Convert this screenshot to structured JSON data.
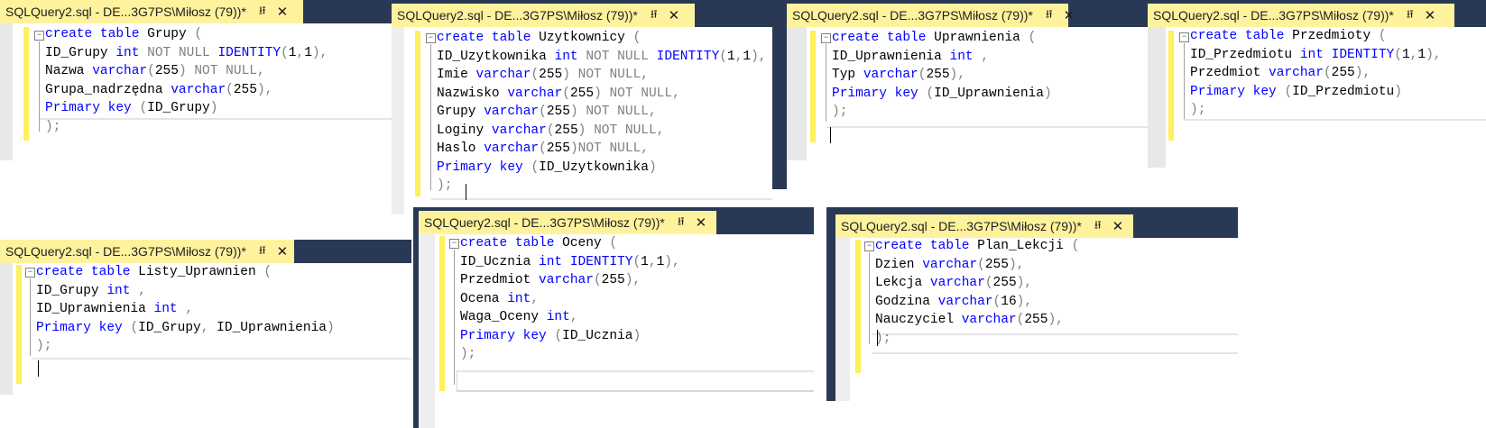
{
  "tab": {
    "title": "SQLQuery2.sql - DE...3G7PS\\Miłosz (79))*",
    "pin_icon": "pin-icon",
    "close_icon": "close-icon"
  },
  "windows": [
    {
      "name": "grupy",
      "lines": [
        [
          [
            "kw",
            "create"
          ],
          [
            "t",
            " "
          ],
          [
            "kw",
            "table"
          ],
          [
            "t",
            " Grupy "
          ],
          [
            "sym",
            "("
          ]
        ],
        [
          [
            "t",
            "ID_Grupy "
          ],
          [
            "kw",
            "int"
          ],
          [
            "t",
            " "
          ],
          [
            "nn",
            "NOT NULL"
          ],
          [
            "t",
            " "
          ],
          [
            "kw",
            "IDENTITY"
          ],
          [
            "sym",
            "("
          ],
          [
            "t",
            "1"
          ],
          [
            "sym",
            ","
          ],
          [
            "t",
            "1"
          ],
          [
            "sym",
            "),"
          ]
        ],
        [
          [
            "t",
            "Nazwa "
          ],
          [
            "kw",
            "varchar"
          ],
          [
            "sym",
            "("
          ],
          [
            "t",
            "255"
          ],
          [
            "sym",
            ")"
          ],
          [
            "t",
            " "
          ],
          [
            "nn",
            "NOT NULL"
          ],
          [
            "sym",
            ","
          ]
        ],
        [
          [
            "t",
            "Grupa_nadrzędna "
          ],
          [
            "kw",
            "varchar"
          ],
          [
            "sym",
            "("
          ],
          [
            "t",
            "255"
          ],
          [
            "sym",
            "),"
          ]
        ],
        [
          [
            "kw",
            "Primary"
          ],
          [
            "t",
            " "
          ],
          [
            "kw",
            "key"
          ],
          [
            "t",
            " "
          ],
          [
            "sym",
            "("
          ],
          [
            "t",
            "ID_Grupy"
          ],
          [
            "sym",
            ")"
          ]
        ],
        [
          [
            "sym",
            ");"
          ]
        ]
      ]
    },
    {
      "name": "uzytkownicy",
      "lines": [
        [
          [
            "kw",
            "create"
          ],
          [
            "t",
            " "
          ],
          [
            "kw",
            "table"
          ],
          [
            "t",
            " Uzytkownicy "
          ],
          [
            "sym",
            "("
          ]
        ],
        [
          [
            "t",
            "ID_Uzytkownika "
          ],
          [
            "kw",
            "int"
          ],
          [
            "t",
            " "
          ],
          [
            "nn",
            "NOT NULL"
          ],
          [
            "t",
            " "
          ],
          [
            "kw",
            "IDENTITY"
          ],
          [
            "sym",
            "("
          ],
          [
            "t",
            "1"
          ],
          [
            "sym",
            ","
          ],
          [
            "t",
            "1"
          ],
          [
            "sym",
            "),"
          ]
        ],
        [
          [
            "t",
            "Imie "
          ],
          [
            "kw",
            "varchar"
          ],
          [
            "sym",
            "("
          ],
          [
            "t",
            "255"
          ],
          [
            "sym",
            ")"
          ],
          [
            "t",
            " "
          ],
          [
            "nn",
            "NOT NULL"
          ],
          [
            "sym",
            ","
          ]
        ],
        [
          [
            "t",
            "Nazwisko "
          ],
          [
            "kw",
            "varchar"
          ],
          [
            "sym",
            "("
          ],
          [
            "t",
            "255"
          ],
          [
            "sym",
            ")"
          ],
          [
            "t",
            " "
          ],
          [
            "nn",
            "NOT NULL"
          ],
          [
            "sym",
            ","
          ]
        ],
        [
          [
            "t",
            "Grupy "
          ],
          [
            "kw",
            "varchar"
          ],
          [
            "sym",
            "("
          ],
          [
            "t",
            "255"
          ],
          [
            "sym",
            ")"
          ],
          [
            "t",
            " "
          ],
          [
            "nn",
            "NOT NULL"
          ],
          [
            "sym",
            ","
          ]
        ],
        [
          [
            "t",
            "Loginy "
          ],
          [
            "kw",
            "varchar"
          ],
          [
            "sym",
            "("
          ],
          [
            "t",
            "255"
          ],
          [
            "sym",
            ")"
          ],
          [
            "t",
            " "
          ],
          [
            "nn",
            "NOT NULL"
          ],
          [
            "sym",
            ","
          ]
        ],
        [
          [
            "t",
            "Haslo "
          ],
          [
            "kw",
            "varchar"
          ],
          [
            "sym",
            "("
          ],
          [
            "t",
            "255"
          ],
          [
            "sym",
            ")"
          ],
          [
            "nn",
            "NOT NULL"
          ],
          [
            "sym",
            ","
          ]
        ],
        [
          [
            "kw",
            "Primary"
          ],
          [
            "t",
            " "
          ],
          [
            "kw",
            "key"
          ],
          [
            "t",
            " "
          ],
          [
            "sym",
            "("
          ],
          [
            "t",
            "ID_Uzytkownika"
          ],
          [
            "sym",
            ")"
          ]
        ],
        [
          [
            "sym",
            ");"
          ]
        ]
      ]
    },
    {
      "name": "uprawnienia",
      "lines": [
        [
          [
            "kw",
            "create"
          ],
          [
            "t",
            " "
          ],
          [
            "kw",
            "table"
          ],
          [
            "t",
            " Uprawnienia "
          ],
          [
            "sym",
            "("
          ]
        ],
        [
          [
            "t",
            "ID_Uprawnienia "
          ],
          [
            "kw",
            "int"
          ],
          [
            "t",
            " "
          ],
          [
            "sym",
            ","
          ]
        ],
        [
          [
            "t",
            "Typ "
          ],
          [
            "kw",
            "varchar"
          ],
          [
            "sym",
            "("
          ],
          [
            "t",
            "255"
          ],
          [
            "sym",
            "),"
          ]
        ],
        [
          [
            "kw",
            "Primary"
          ],
          [
            "t",
            " "
          ],
          [
            "kw",
            "key"
          ],
          [
            "t",
            " "
          ],
          [
            "sym",
            "("
          ],
          [
            "t",
            "ID_Uprawnienia"
          ],
          [
            "sym",
            ")"
          ]
        ],
        [
          [
            "sym",
            ");"
          ]
        ]
      ]
    },
    {
      "name": "przedmioty",
      "lines": [
        [
          [
            "kw",
            "create"
          ],
          [
            "t",
            " "
          ],
          [
            "kw",
            "table"
          ],
          [
            "t",
            " Przedmioty "
          ],
          [
            "sym",
            "("
          ]
        ],
        [
          [
            "t",
            "ID_Przedmiotu "
          ],
          [
            "kw",
            "int"
          ],
          [
            "t",
            " "
          ],
          [
            "kw",
            "IDENTITY"
          ],
          [
            "sym",
            "("
          ],
          [
            "t",
            "1"
          ],
          [
            "sym",
            ","
          ],
          [
            "t",
            "1"
          ],
          [
            "sym",
            "),"
          ]
        ],
        [
          [
            "t",
            "Przedmiot "
          ],
          [
            "kw",
            "varchar"
          ],
          [
            "sym",
            "("
          ],
          [
            "t",
            "255"
          ],
          [
            "sym",
            "),"
          ]
        ],
        [
          [
            "kw",
            "Primary"
          ],
          [
            "t",
            " "
          ],
          [
            "kw",
            "key"
          ],
          [
            "t",
            " "
          ],
          [
            "sym",
            "("
          ],
          [
            "t",
            "ID_Przedmiotu"
          ],
          [
            "sym",
            ")"
          ]
        ],
        [
          [
            "sym",
            ");"
          ]
        ]
      ]
    },
    {
      "name": "listy-uprawnien",
      "lines": [
        [
          [
            "kw",
            "create"
          ],
          [
            "t",
            " "
          ],
          [
            "kw",
            "table"
          ],
          [
            "t",
            " Listy_Uprawnien "
          ],
          [
            "sym",
            "("
          ]
        ],
        [
          [
            "t",
            "ID_Grupy "
          ],
          [
            "kw",
            "int"
          ],
          [
            "t",
            " "
          ],
          [
            "sym",
            ","
          ]
        ],
        [
          [
            "t",
            "ID_Uprawnienia "
          ],
          [
            "kw",
            "int"
          ],
          [
            "t",
            " "
          ],
          [
            "sym",
            ","
          ]
        ],
        [
          [
            "kw",
            "Primary"
          ],
          [
            "t",
            " "
          ],
          [
            "kw",
            "key"
          ],
          [
            "t",
            " "
          ],
          [
            "sym",
            "("
          ],
          [
            "t",
            "ID_Grupy"
          ],
          [
            "sym",
            ","
          ],
          [
            "t",
            " ID_Uprawnienia"
          ],
          [
            "sym",
            ")"
          ]
        ],
        [
          [
            "sym",
            ");"
          ]
        ]
      ]
    },
    {
      "name": "oceny",
      "lines": [
        [
          [
            "kw",
            "create"
          ],
          [
            "t",
            " "
          ],
          [
            "kw",
            "table"
          ],
          [
            "t",
            " Oceny "
          ],
          [
            "sym",
            "("
          ]
        ],
        [
          [
            "t",
            "ID_Ucznia "
          ],
          [
            "kw",
            "int"
          ],
          [
            "t",
            " "
          ],
          [
            "kw",
            "IDENTITY"
          ],
          [
            "sym",
            "("
          ],
          [
            "t",
            "1"
          ],
          [
            "sym",
            ","
          ],
          [
            "t",
            "1"
          ],
          [
            "sym",
            "),"
          ]
        ],
        [
          [
            "t",
            "Przedmiot "
          ],
          [
            "kw",
            "varchar"
          ],
          [
            "sym",
            "("
          ],
          [
            "t",
            "255"
          ],
          [
            "sym",
            "),"
          ]
        ],
        [
          [
            "t",
            "Ocena "
          ],
          [
            "kw",
            "int"
          ],
          [
            "sym",
            ","
          ]
        ],
        [
          [
            "t",
            "Waga_Oceny "
          ],
          [
            "kw",
            "int"
          ],
          [
            "sym",
            ","
          ]
        ],
        [
          [
            "kw",
            "Primary"
          ],
          [
            "t",
            " "
          ],
          [
            "kw",
            "key"
          ],
          [
            "t",
            " "
          ],
          [
            "sym",
            "("
          ],
          [
            "t",
            "ID_Ucznia"
          ],
          [
            "sym",
            ")"
          ]
        ],
        [
          [
            "sym",
            ");"
          ]
        ]
      ]
    },
    {
      "name": "plan-lekcji",
      "lines": [
        [
          [
            "kw",
            "create"
          ],
          [
            "t",
            " "
          ],
          [
            "kw",
            "table"
          ],
          [
            "t",
            " Plan_Lekcji "
          ],
          [
            "sym",
            "("
          ]
        ],
        [
          [
            "t",
            "Dzien "
          ],
          [
            "kw",
            "varchar"
          ],
          [
            "sym",
            "("
          ],
          [
            "t",
            "255"
          ],
          [
            "sym",
            "),"
          ]
        ],
        [
          [
            "t",
            "Lekcja "
          ],
          [
            "kw",
            "varchar"
          ],
          [
            "sym",
            "("
          ],
          [
            "t",
            "255"
          ],
          [
            "sym",
            "),"
          ]
        ],
        [
          [
            "t",
            "Godzina "
          ],
          [
            "kw",
            "varchar"
          ],
          [
            "sym",
            "("
          ],
          [
            "t",
            "16"
          ],
          [
            "sym",
            "),"
          ]
        ],
        [
          [
            "t",
            "Nauczyciel "
          ],
          [
            "kw",
            "varchar"
          ],
          [
            "sym",
            "("
          ],
          [
            "t",
            "255"
          ],
          [
            "sym",
            "),"
          ]
        ],
        [
          [
            "sym",
            ");"
          ]
        ]
      ]
    }
  ]
}
